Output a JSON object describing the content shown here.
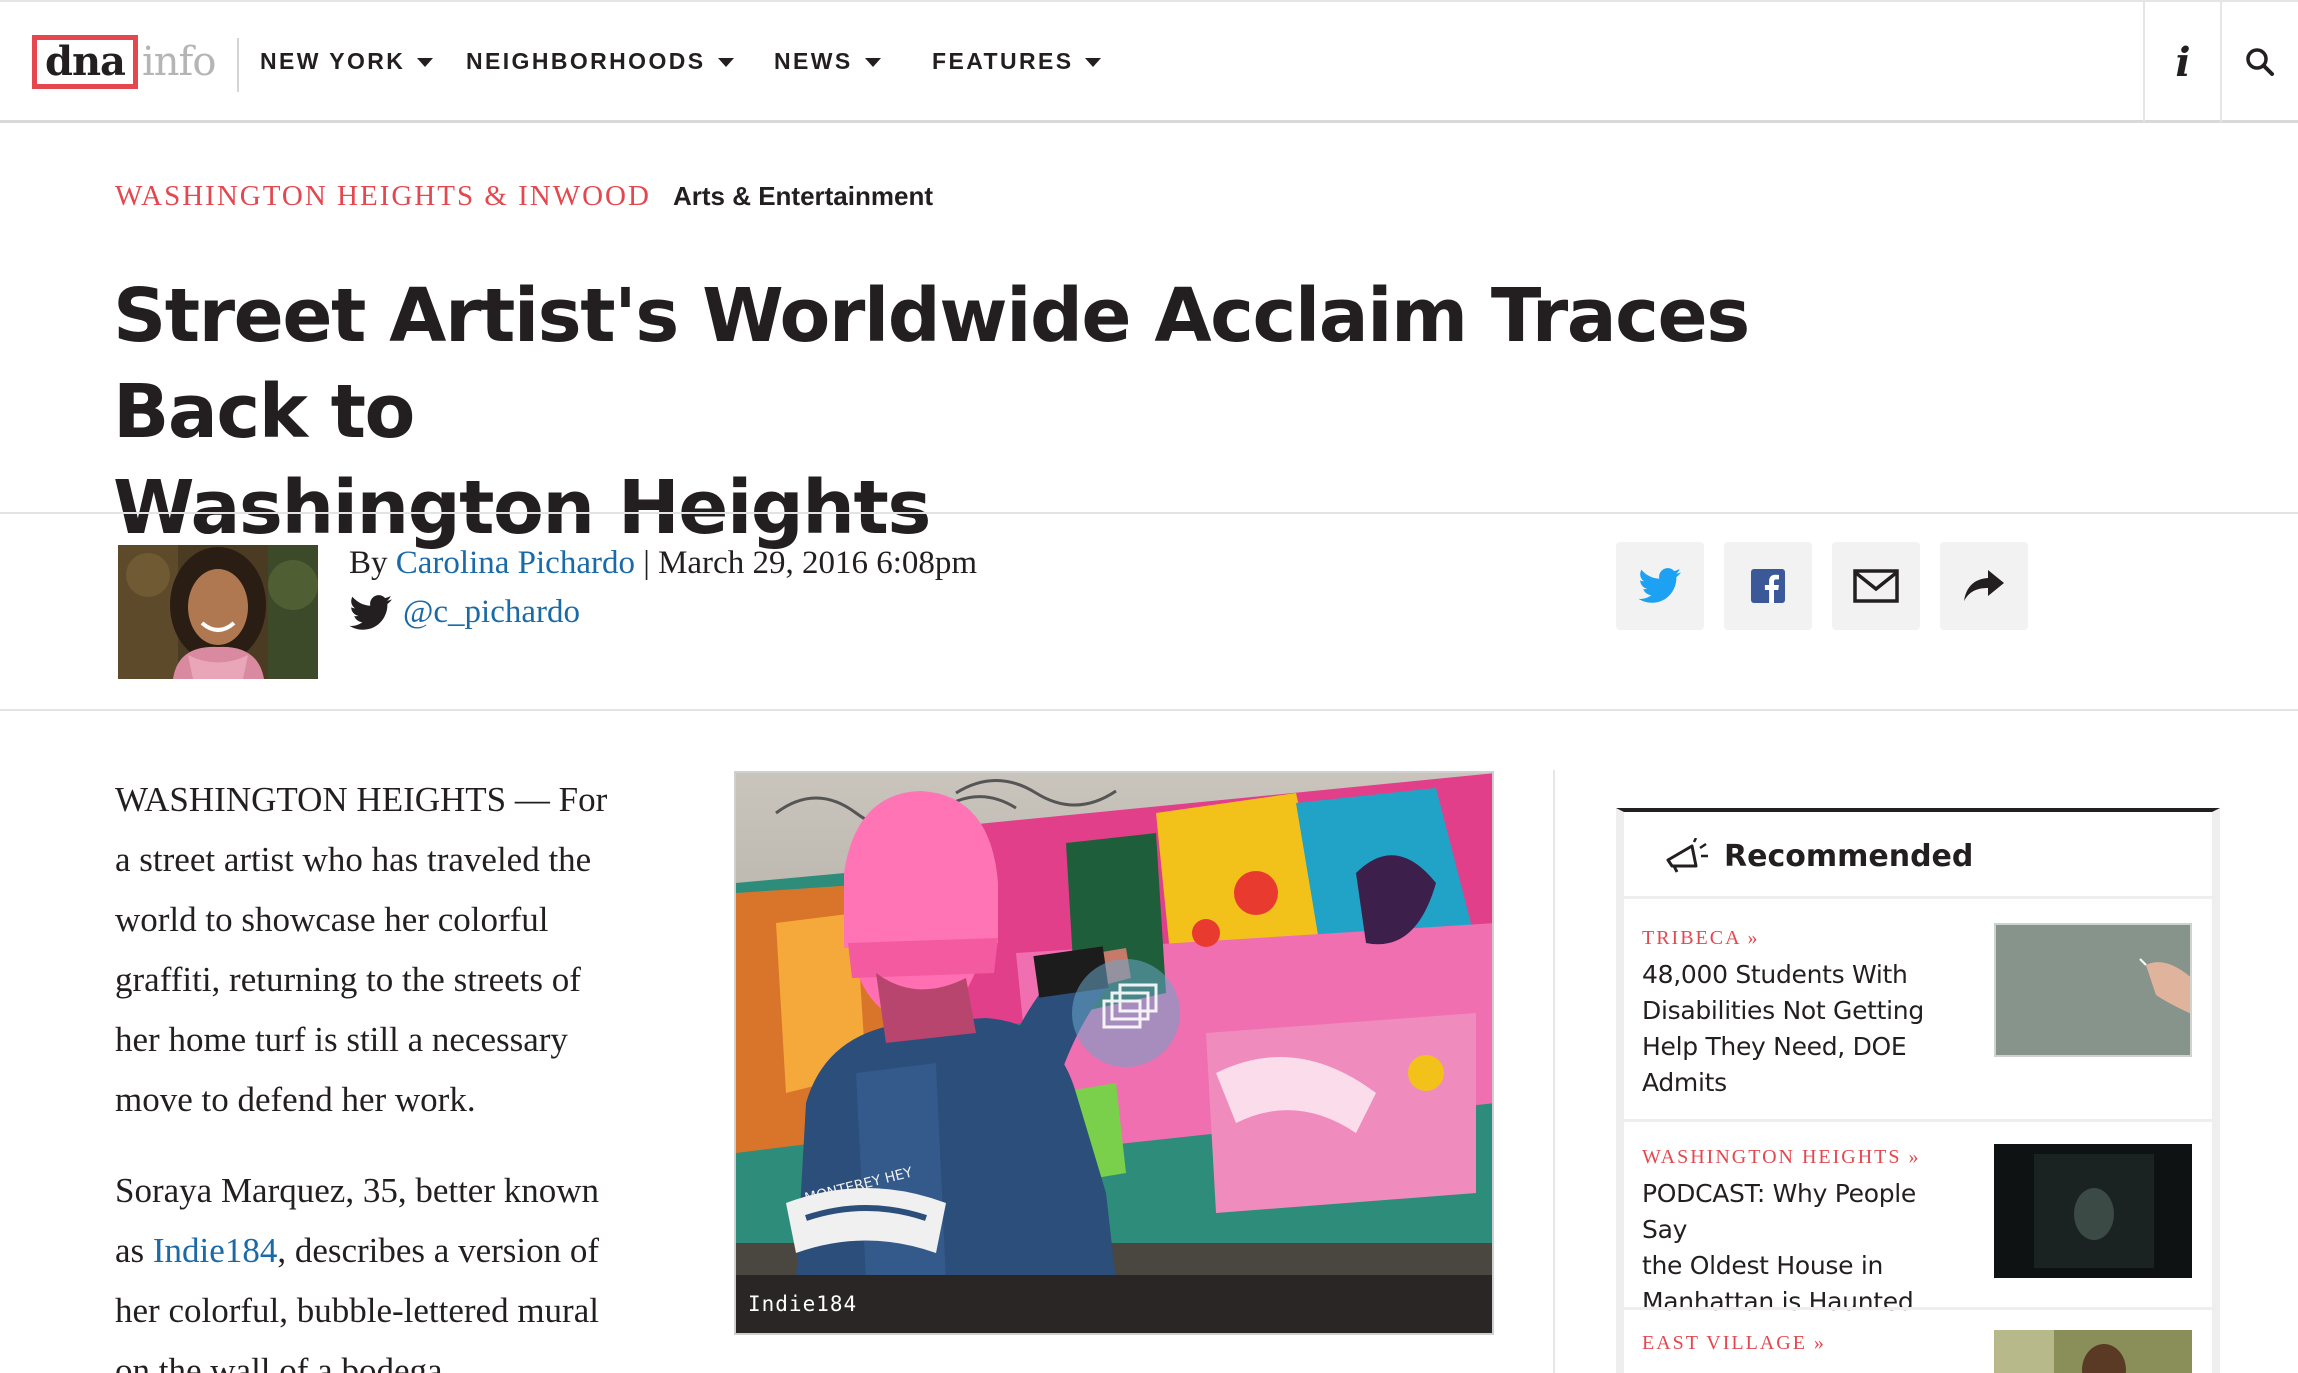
{
  "nav": {
    "logo_dna": "dna",
    "logo_info": "info",
    "items": [
      {
        "label": "NEW YORK"
      },
      {
        "label": "NEIGHBORHOODS"
      },
      {
        "label": "NEWS"
      },
      {
        "label": "FEATURES"
      }
    ],
    "icons": [
      "info-icon",
      "search-icon"
    ]
  },
  "article": {
    "neighborhood": "WASHINGTON HEIGHTS & INWOOD",
    "category": "Arts & Entertainment",
    "headline_line1": "Street Artist's Worldwide Acclaim Traces Back to",
    "headline_line2": "Washington Heights",
    "byline_prefix": "By ",
    "author": "Carolina Pichardo",
    "date_sep": " | ",
    "date": "March 29, 2016 6:08pm",
    "twitter": "@c_pichardo",
    "paragraph1_lines": [
      "WASHINGTON HEIGHTS — For",
      "a street artist who has traveled the",
      "world to showcase her colorful",
      "graffiti, returning to the streets of",
      "her home turf is still a necessary",
      "move to defend her work."
    ],
    "paragraph2_line1": "Soraya Marquez, 35, better known",
    "paragraph2_as": "as ",
    "paragraph2_link": "Indie184",
    "paragraph2_after_link": ", describes a version of",
    "paragraph2_line3": "her colorful, bubble-lettered mural",
    "paragraph2_line4": "on the wall of a bodega",
    "image_caption": "Indie184",
    "jacket_text": "MONTEREY HEY"
  },
  "share": {
    "buttons": [
      "twitter-icon",
      "facebook-icon",
      "email-icon",
      "share-arrow-icon"
    ],
    "colors": {
      "twitter": "#1da1f2",
      "facebook": "#3b5998",
      "dark": "#231f20"
    }
  },
  "sidebar": {
    "title": "Recommended",
    "items": [
      {
        "neighborhood": "TRIBECA »",
        "headline": [
          "48,000 Students With",
          "Disabilities Not Getting",
          "Help They Need, DOE",
          "Admits"
        ]
      },
      {
        "neighborhood": "WASHINGTON HEIGHTS »",
        "headline": [
          "PODCAST: Why People Say",
          "the Oldest House in",
          "Manhattan is Haunted"
        ]
      },
      {
        "neighborhood": "EAST VILLAGE »",
        "headline": []
      }
    ]
  },
  "colors": {
    "accent": "#e5474f",
    "link": "#1a6aa8",
    "text": "#231f20"
  }
}
